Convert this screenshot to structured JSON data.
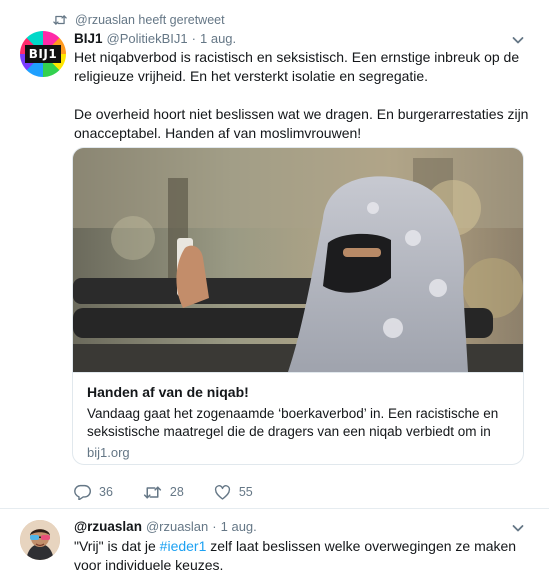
{
  "retweet_notice": {
    "text": "@rzuaslan heeft geretweet"
  },
  "tweet1": {
    "avatar_text": "BIJ1",
    "name": "BIJ1",
    "handle": "@PolitiekBIJ1",
    "separator": "·",
    "date": "1 aug.",
    "paragraph1": "Het niqabverbod is racistisch en seksistisch. Een ernstige inbreuk op de religieuze vrijheid. En het versterkt isolatie en segregatie.",
    "paragraph2": "De overheid hoort niet beslissen wat we dragen. En burgerarrestaties zijn onacceptabel. Handen af van moslimvrouwen!",
    "card": {
      "title": "Handen af van de niqab!",
      "description": "Vandaag gaat het zogenaamde ‘boerkaverbod’ in. Een racistische en seksistische maatregel die de dragers van een niqab verbiedt om in be...",
      "domain": "bij1.org"
    },
    "actions": {
      "replies": "36",
      "retweets": "28",
      "likes": "55"
    }
  },
  "tweet2": {
    "name": "@rzuaslan",
    "handle": "@rzuaslan",
    "separator": "·",
    "date": "1 aug.",
    "text_before": "\"Vrij\" is dat je ",
    "hashtag": "#ieder1",
    "text_after": " zelf laat beslissen welke overwegingen ze maken voor individuele keuzes."
  },
  "colors": {
    "accent": "#1da1f2",
    "muted": "#657786",
    "text": "#14171a",
    "border": "#e1e8ed"
  },
  "icons": [
    "retweet-icon",
    "chevron-down-icon",
    "reply-icon",
    "heart-icon"
  ]
}
